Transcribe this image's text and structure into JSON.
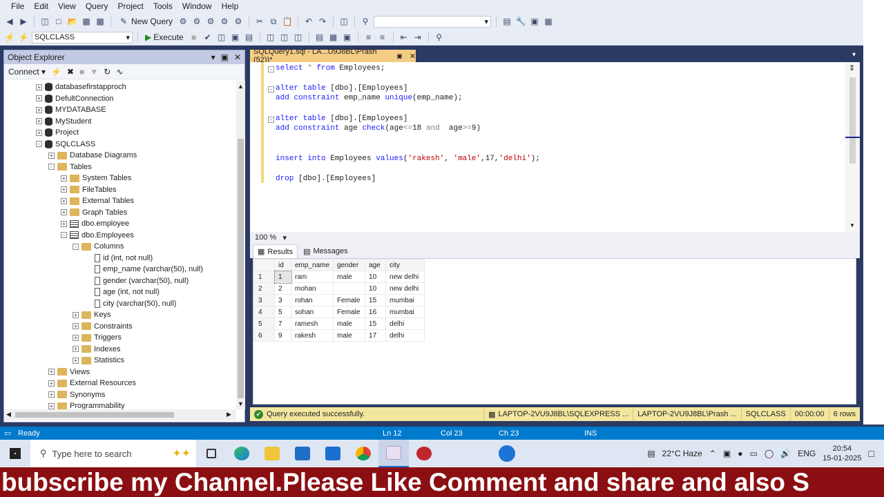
{
  "menu": [
    "File",
    "Edit",
    "View",
    "Query",
    "Project",
    "Tools",
    "Window",
    "Help"
  ],
  "toolbar": {
    "new_query_label": "New Query",
    "execute_label": "Execute",
    "database_combo": "SQLCLASS",
    "search_combo_value": ""
  },
  "object_explorer": {
    "title": "Object Explorer",
    "pin": "↕",
    "connect_label": "Connect",
    "tree": [
      {
        "label": "databasefirstapproch",
        "level": 0,
        "icon": "database",
        "expander": "+"
      },
      {
        "label": "DefultConnection",
        "level": 0,
        "icon": "database",
        "expander": "+"
      },
      {
        "label": "MYDATABASE",
        "level": 0,
        "icon": "database",
        "expander": "+"
      },
      {
        "label": "MyStudent",
        "level": 0,
        "icon": "database",
        "expander": "+"
      },
      {
        "label": "Project",
        "level": 0,
        "icon": "database",
        "expander": "+"
      },
      {
        "label": "SQLCLASS",
        "level": 0,
        "icon": "database",
        "expander": "-"
      },
      {
        "label": "Database Diagrams",
        "level": 1,
        "icon": "folder",
        "expander": "+"
      },
      {
        "label": "Tables",
        "level": 1,
        "icon": "folder",
        "expander": "-"
      },
      {
        "label": "System Tables",
        "level": 2,
        "icon": "folder",
        "expander": "+"
      },
      {
        "label": "FileTables",
        "level": 2,
        "icon": "folder",
        "expander": "+"
      },
      {
        "label": "External Tables",
        "level": 2,
        "icon": "folder",
        "expander": "+"
      },
      {
        "label": "Graph Tables",
        "level": 2,
        "icon": "folder",
        "expander": "+"
      },
      {
        "label": "dbo.employee",
        "level": 2,
        "icon": "table",
        "expander": "+"
      },
      {
        "label": "dbo.Employees",
        "level": 2,
        "icon": "table",
        "expander": "-"
      },
      {
        "label": "Columns",
        "level": 3,
        "icon": "folder",
        "expander": "-"
      },
      {
        "label": "id (int, not null)",
        "level": 4,
        "icon": "column",
        "expander": ""
      },
      {
        "label": "emp_name (varchar(50), null)",
        "level": 4,
        "icon": "column",
        "expander": ""
      },
      {
        "label": "gender (varchar(50), null)",
        "level": 4,
        "icon": "column",
        "expander": ""
      },
      {
        "label": "age (int, not null)",
        "level": 4,
        "icon": "column",
        "expander": ""
      },
      {
        "label": "city (varchar(50), null)",
        "level": 4,
        "icon": "column",
        "expander": ""
      },
      {
        "label": "Keys",
        "level": 3,
        "icon": "folder",
        "expander": "+"
      },
      {
        "label": "Constraints",
        "level": 3,
        "icon": "folder",
        "expander": "+"
      },
      {
        "label": "Triggers",
        "level": 3,
        "icon": "folder",
        "expander": "+"
      },
      {
        "label": "Indexes",
        "level": 3,
        "icon": "folder",
        "expander": "+"
      },
      {
        "label": "Statistics",
        "level": 3,
        "icon": "folder",
        "expander": "+"
      },
      {
        "label": "Views",
        "level": 1,
        "icon": "folder",
        "expander": "+"
      },
      {
        "label": "External Resources",
        "level": 1,
        "icon": "folder",
        "expander": "+"
      },
      {
        "label": "Synonyms",
        "level": 1,
        "icon": "folder",
        "expander": "+"
      },
      {
        "label": "Programmability",
        "level": 1,
        "icon": "folder",
        "expander": "+"
      }
    ]
  },
  "editor": {
    "tab_title": "SQLQuery1.sql - LA...U9J8BL\\Prash (52))*",
    "lines": [
      {
        "tokens": [
          [
            "kw",
            "select"
          ],
          [
            "op",
            " * "
          ],
          [
            "kw",
            "from"
          ],
          [
            "txt",
            " Employees;"
          ]
        ],
        "fold": true
      },
      {
        "tokens": [],
        "fold": false
      },
      {
        "tokens": [
          [
            "kw",
            "alter table"
          ],
          [
            "txt",
            " [dbo].[Employees]"
          ]
        ],
        "fold": true
      },
      {
        "tokens": [
          [
            "kw",
            "add constraint"
          ],
          [
            "txt",
            " emp_name "
          ],
          [
            "kw",
            "unique"
          ],
          [
            "txt",
            "(emp_name);"
          ]
        ],
        "fold": false
      },
      {
        "tokens": [],
        "fold": false
      },
      {
        "tokens": [
          [
            "kw",
            "alter table"
          ],
          [
            "txt",
            " [dbo].[Employees]"
          ]
        ],
        "fold": true
      },
      {
        "tokens": [
          [
            "kw",
            "add constraint"
          ],
          [
            "txt",
            " age "
          ],
          [
            "kw",
            "check"
          ],
          [
            "txt",
            "(age"
          ],
          [
            "op",
            "<="
          ],
          [
            "txt",
            "18 "
          ],
          [
            "op",
            "and"
          ],
          [
            "txt",
            "  age"
          ],
          [
            "op",
            ">="
          ],
          [
            "txt",
            "9)"
          ]
        ],
        "fold": false
      },
      {
        "tokens": [],
        "fold": false
      },
      {
        "tokens": [],
        "fold": false
      },
      {
        "tokens": [
          [
            "kw",
            "insert into"
          ],
          [
            "txt",
            " Employees "
          ],
          [
            "kw",
            "values"
          ],
          [
            "txt",
            "("
          ],
          [
            "str",
            "'rakesh'"
          ],
          [
            "txt",
            ", "
          ],
          [
            "str",
            "'male'"
          ],
          [
            "txt",
            ",17,"
          ],
          [
            "str",
            "'delhi'"
          ],
          [
            "txt",
            ");"
          ]
        ],
        "fold": false
      },
      {
        "tokens": [],
        "fold": false
      },
      {
        "tokens": [
          [
            "kw",
            "drop"
          ],
          [
            "txt",
            " [dbo].[Employees]"
          ]
        ],
        "fold": false
      }
    ],
    "zoom": "100 %"
  },
  "results": {
    "tab_results": "Results",
    "tab_messages": "Messages",
    "columns": [
      "id",
      "emp_name",
      "gender",
      "age",
      "city"
    ],
    "rows": [
      [
        "1",
        "1",
        "ram",
        "male",
        "10",
        "new delhi"
      ],
      [
        "2",
        "2",
        "mohan",
        "",
        "10",
        "new delhi"
      ],
      [
        "3",
        "3",
        "rohan",
        "Female",
        "15",
        "mumbai"
      ],
      [
        "4",
        "5",
        "sohan",
        "Female",
        "16",
        "mumbai"
      ],
      [
        "5",
        "7",
        "ramesh",
        "male",
        "15",
        "delhi"
      ],
      [
        "6",
        "9",
        "rakesh",
        "male",
        "17",
        "delhi"
      ]
    ]
  },
  "query_status": {
    "message": "Query executed successfully.",
    "server": "LAPTOP-2VU9J8BL\\SQLEXPRESS ...",
    "user": "LAPTOP-2VU9J8BL\\Prash ...",
    "database": "SQLCLASS",
    "elapsed": "00:00:00",
    "rows": "6 rows"
  },
  "statusbar": {
    "ready": "Ready",
    "ln": "Ln 12",
    "col": "Col 23",
    "ch": "Ch 23",
    "ins": "INS"
  },
  "taskbar": {
    "search_placeholder": "Type here to search",
    "weather": "22°C  Haze",
    "lang": "ENG",
    "time": "20:54",
    "date": "15-01-2025"
  },
  "banner_text": "bubscribe my Channel.Please Like Comment and share and also S"
}
